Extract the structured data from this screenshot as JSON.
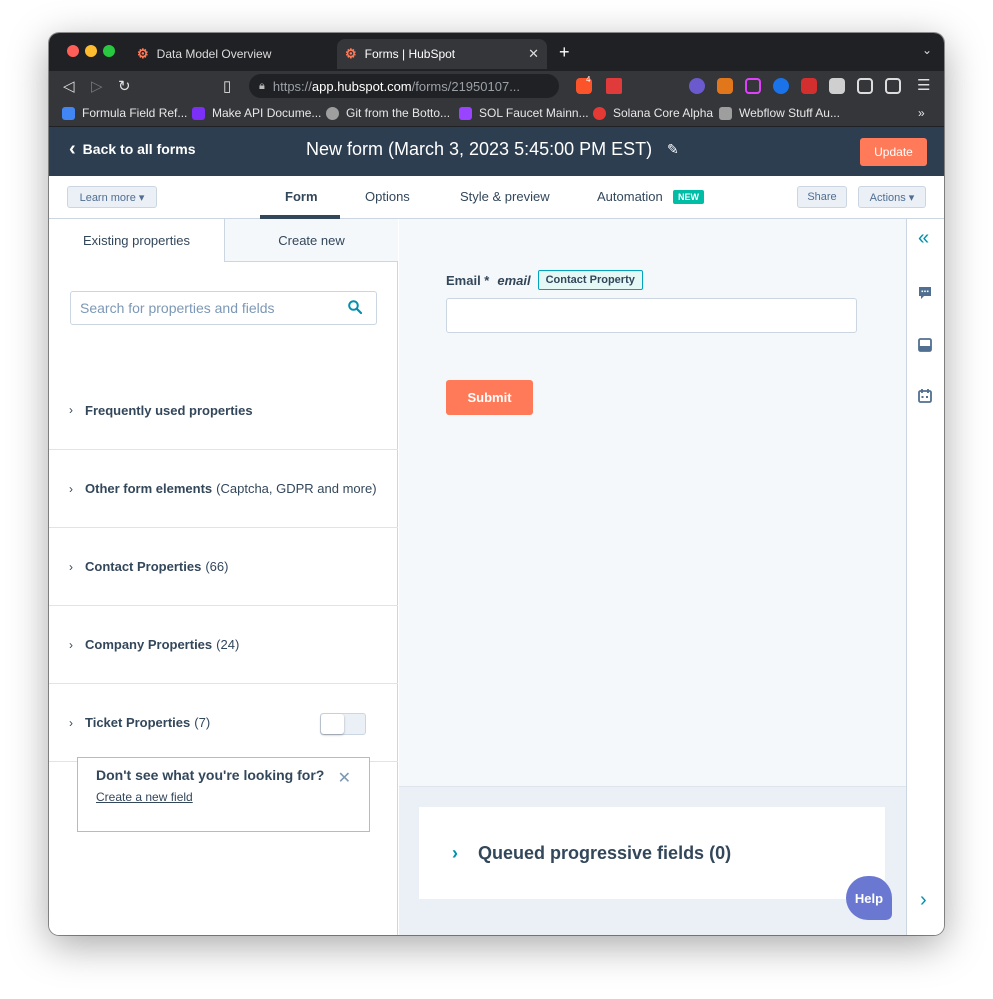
{
  "browser": {
    "tabs": [
      {
        "title": "Data Model Overview",
        "active": false
      },
      {
        "title": "Forms | HubSpot",
        "active": true
      }
    ],
    "url_prefix": "https://",
    "url_host": "app.hubspot.com",
    "url_path": "/forms/21950107...",
    "shield_badge": "4",
    "bookmarks": [
      {
        "label": "Formula Field Ref...",
        "color": "#4285f4"
      },
      {
        "label": "Make API Docume...",
        "color": "#7b2ff7"
      },
      {
        "label": "Git from the Botto...",
        "color": "#9e9e9e"
      },
      {
        "label": "SOL Faucet Mainn...",
        "color": "#9945ff"
      },
      {
        "label": "Solana Core Alpha",
        "color": "#e53935"
      },
      {
        "label": "Webflow Stuff Au...",
        "color": "#9e9e9e"
      }
    ],
    "more_bookmarks": "»"
  },
  "header": {
    "back_label": "Back to all forms",
    "form_title": "New form (March 3, 2023 5:45:00 PM EST)",
    "update_label": "Update"
  },
  "subnav": {
    "learn_more": "Learn more ▾",
    "tabs": [
      "Form",
      "Options",
      "Style & preview",
      "Automation"
    ],
    "new_badge": "NEW",
    "share": "Share",
    "actions": "Actions ▾"
  },
  "left": {
    "tab_existing": "Existing properties",
    "tab_create": "Create new",
    "search_placeholder": "Search for properties and fields",
    "sections": [
      {
        "bold": "Frequently used properties",
        "rest": ""
      },
      {
        "bold": "Other form elements",
        "rest": "(Captcha, GDPR and more)"
      },
      {
        "bold": "Contact Properties",
        "rest": "(66)"
      },
      {
        "bold": "Company Properties",
        "rest": "(24)"
      },
      {
        "bold": "Ticket Properties",
        "rest": "(7)"
      }
    ],
    "help_heading": "Don't see what you're looking for?",
    "help_link": "Create a new field"
  },
  "canvas": {
    "field_label": "Email *",
    "field_internal": "email",
    "field_badge": "Contact Property",
    "submit_label": "Submit",
    "queued_label": "Queued progressive fields (0)",
    "help_button": "Help"
  },
  "colors": {
    "accent": "#ff7a59",
    "header_bg": "#2d3e50",
    "teal": "#00bda5",
    "help": "#6a78d1"
  }
}
